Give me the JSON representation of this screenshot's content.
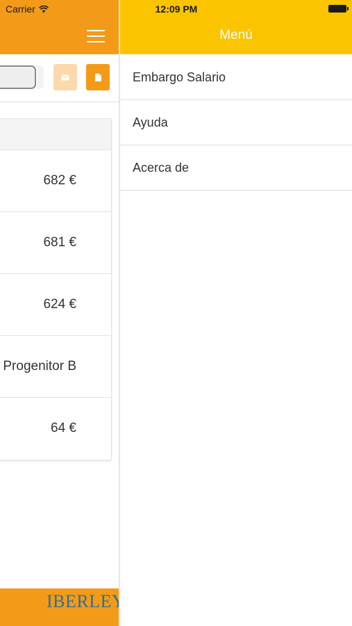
{
  "status_bar": {
    "carrier": "Carrier",
    "time": "12:09 PM"
  },
  "left_panel": {
    "rows": [
      {
        "value": "682 €"
      },
      {
        "value": "681 €"
      },
      {
        "value": "624 €"
      },
      {
        "value": "Progenitor B"
      },
      {
        "value": "64 €"
      }
    ],
    "footer_logo": "IBERLEY"
  },
  "menu": {
    "title": "Menú",
    "items": [
      {
        "label": "Embargo Salario"
      },
      {
        "label": "Ayuda"
      },
      {
        "label": "Acerca de"
      }
    ]
  },
  "colors": {
    "accent_orange": "#f39b18",
    "menu_yellow": "#fbc400",
    "logo_blue": "#2f6f9a"
  },
  "icons": [
    "wifi-icon",
    "hamburger-icon",
    "mail-icon",
    "document-icon",
    "battery-icon"
  ]
}
